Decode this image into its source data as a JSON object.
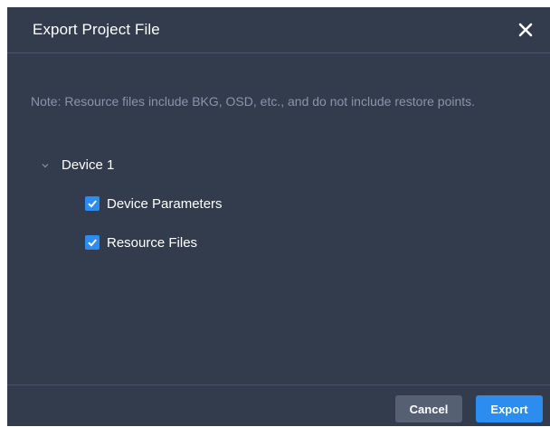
{
  "dialog": {
    "title": "Export Project File",
    "close_icon": "close-icon",
    "note": "Note: Resource files include BKG, OSD, etc., and do not include restore points.",
    "tree": {
      "device_label": "Device 1",
      "toggle_icon": "chevron-down-icon",
      "expanded": true,
      "options": [
        {
          "label": "Device Parameters",
          "checked": true
        },
        {
          "label": "Resource Files",
          "checked": true
        }
      ]
    },
    "footer": {
      "cancel_label": "Cancel",
      "export_label": "Export"
    }
  },
  "colors": {
    "dialog_bg": "#323c4d",
    "accent": "#2d8cf0",
    "note_text": "#8b95a6",
    "cancel_bg": "#556073"
  }
}
